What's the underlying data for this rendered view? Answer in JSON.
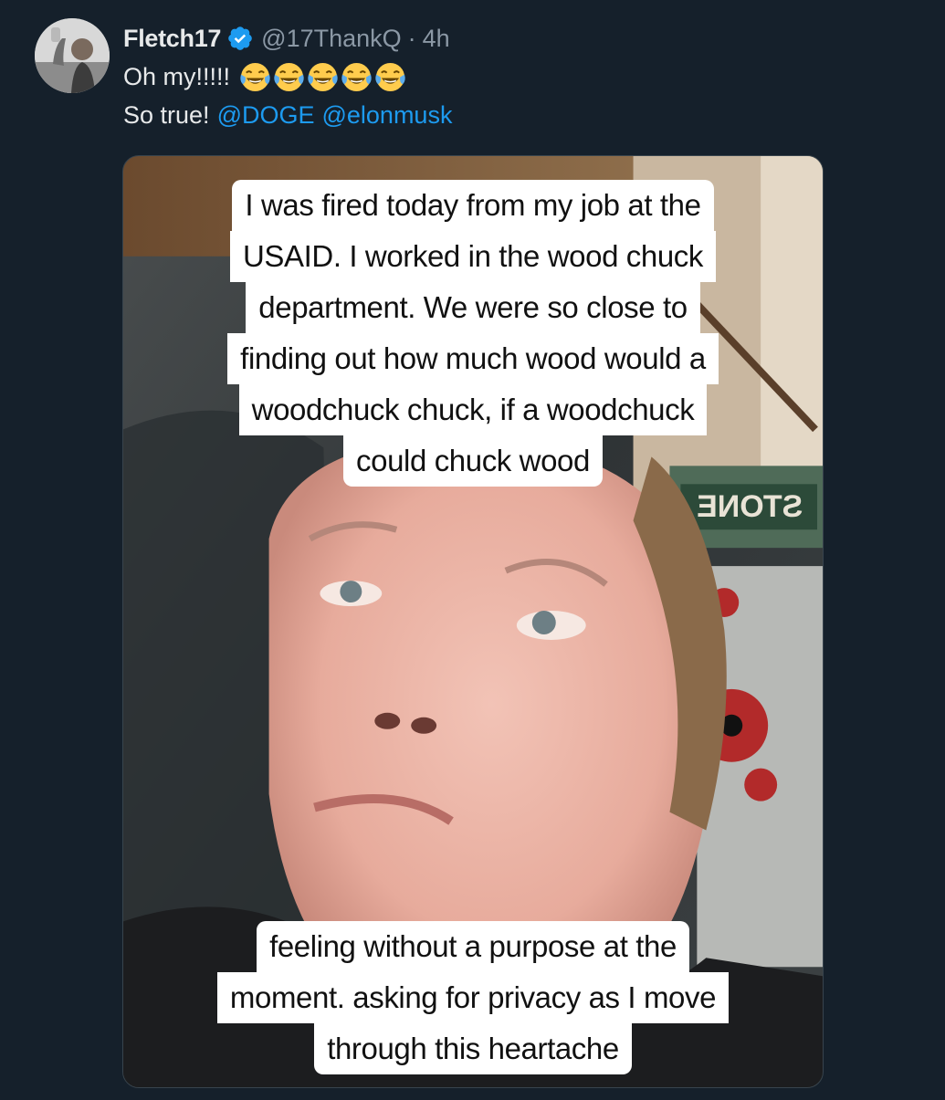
{
  "tweet": {
    "display_name": "Fletch17",
    "handle": "@17ThankQ",
    "separator": "·",
    "time": "4h",
    "text_line1": "Oh my!!!!!",
    "emoji_icons": [
      "joy-emoji",
      "joy-emoji",
      "joy-emoji",
      "joy-emoji",
      "joy-emoji"
    ],
    "text_line2": "So true!",
    "mentions": [
      "@DOGE",
      "@elonmusk"
    ]
  },
  "media": {
    "caption_top": [
      "I was fired today from my job at the",
      "USAID. I worked in the wood chuck",
      "department. We were so close to",
      "finding out how much wood would a",
      "woodchuck chuck, if a woodchuck",
      "could chuck wood"
    ],
    "caption_bottom": [
      "feeling without a purpose at the",
      "moment. asking for privacy as I move",
      "through this heartache"
    ],
    "sign_text": "STONE"
  },
  "colors": {
    "background": "#15202b",
    "accent": "#1d9bf0",
    "text": "#e7e9ea",
    "muted": "#8b98a5"
  }
}
